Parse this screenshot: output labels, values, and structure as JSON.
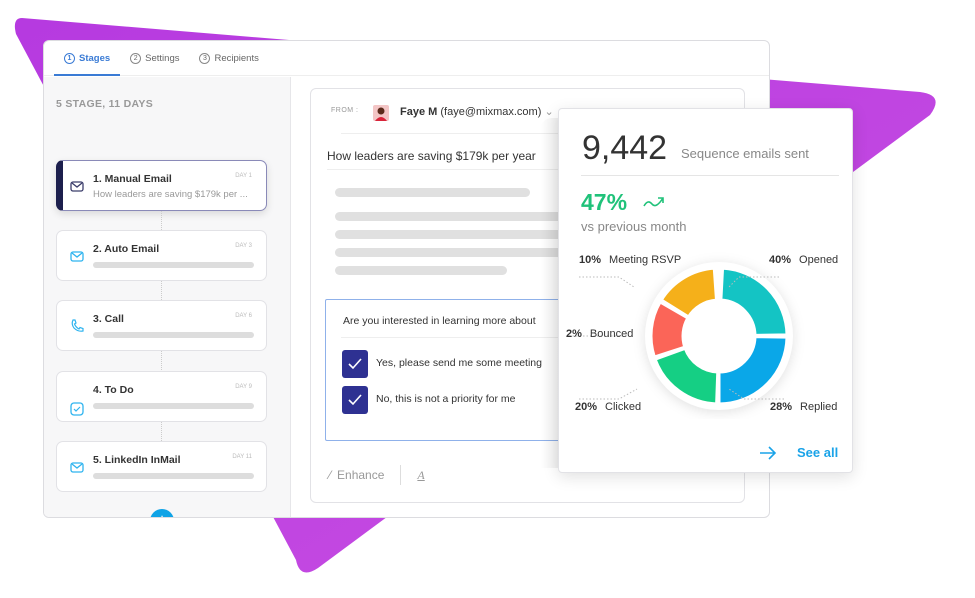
{
  "colors": {
    "brand_purple": "#b83fe0",
    "accent_blue": "#3a7bd5",
    "plus_blue": "#0fa3e6",
    "checkbox": "#2e3192",
    "growth_green": "#20c27a"
  },
  "tabs": [
    {
      "num": "1",
      "label": "Stages",
      "active": true
    },
    {
      "num": "2",
      "label": "Settings"
    },
    {
      "num": "3",
      "label": "Recipients"
    }
  ],
  "sequence": {
    "header": "5 STAGE, 11 DAYS",
    "stages": [
      {
        "title": "1. Manual Email",
        "day": "DAY 1",
        "subtitle": "How leaders are saving $179k per ...",
        "icon": "mail-icon"
      },
      {
        "title": "2. Auto Email",
        "day": "DAY 3",
        "icon": "mail-icon"
      },
      {
        "title": "3. Call",
        "day": "DAY 6",
        "icon": "phone-icon"
      },
      {
        "title": "4. To Do",
        "day": "DAY 9",
        "icon": "checkbox-icon"
      },
      {
        "title": "5. LinkedIn InMail",
        "day": "DAY 11",
        "icon": "mail-icon"
      }
    ],
    "add_label": "+"
  },
  "email": {
    "from_label": "FROM :",
    "sender_name": "Faye M",
    "sender_email": "(faye@mixmax.com)",
    "subject": "How leaders are saving $179k per year",
    "survey": {
      "question": "Are you interested in learning more about",
      "options": [
        "Yes, please send me some meeting",
        "No, this is not a priority for me"
      ]
    },
    "toolbar": {
      "enhance": "Enhance",
      "font": "A"
    }
  },
  "stats": {
    "count": "9,442",
    "count_label": "Sequence emails sent",
    "growth": "47%",
    "growth_label": "vs previous month",
    "see_all": "See all"
  },
  "chart_data": {
    "type": "pie",
    "variant": "donut",
    "slices": [
      {
        "label": "Opened",
        "value": 40,
        "display": "40%",
        "color": "#14c4c4"
      },
      {
        "label": "Replied",
        "value": 28,
        "display": "28%",
        "color": "#0aa7e8"
      },
      {
        "label": "Clicked",
        "value": 20,
        "display": "20%",
        "color": "#15cf84"
      },
      {
        "label": "Bounced",
        "value": 2,
        "display": "2%",
        "color": "#fb6558"
      },
      {
        "label": "Meeting RSVP",
        "value": 10,
        "display": "10%",
        "color": "#f5b01a"
      }
    ]
  }
}
